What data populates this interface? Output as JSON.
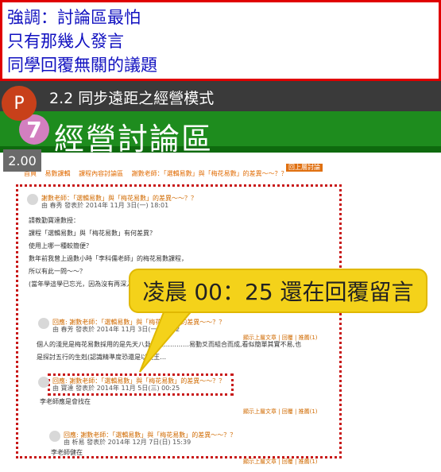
{
  "note_box": {
    "lines": [
      "強調：討論區最怕",
      "只有那幾人發言",
      "同學回覆無關的議題"
    ]
  },
  "slide": {
    "badge_letter": "P",
    "title": "2.2 同步遠距之經營模式",
    "number_icon": "7",
    "forum_title": "經營討論區",
    "speed": "2.00",
    "board_button": "回上層討論區",
    "nav_links": [
      "首頁",
      "易數課輯",
      "課程內容討論區",
      "謝數老師：「選輯易數」與「梅花易數」的差異～～？？"
    ]
  },
  "posts": [
    {
      "title": "謝數老師：「選輯易數」與「梅花易數」的差異～～？？",
      "meta": "由 春秀 發表於 2014年 11月 3日(一) 18:01",
      "body": [
        "請教勤寶達數授：",
        "課程「選輯易數」與「梅花易數」有何差異？",
        "使用上哪一種較簡便？",
        "數年前我曾上過數小時「李科儒老師」的梅花易數課程，",
        "所以有此一問～～？",
        "(當年學這學已忘光，因為沒有再深入研究)"
      ]
    },
    {
      "title": "回應: 謝數老師：「選輯易數」與「梅花易數」的差異～～？？",
      "meta": "由 春芳 發表於 2014年 11月 3日(一) 23:22",
      "body": [
        "個人的淺見是梅花易數採用的是先天八卦與以…………易動爻而組合而成,看似簡單其實不易,也",
        "是探討五行的生剋(認識精準度恐還是以文王…"
      ]
    },
    {
      "title": "回應: 謝數老師：「選輯易數」與「梅花易數」的差異～～？？",
      "meta": "由 寶達 發表於 2014年 11月 5日(三) 00:25",
      "body": [
        "李老師應是會找在"
      ]
    },
    {
      "title": "回應: 謝數老師：「選輯易數」與「梅花易數」的差異～～？？",
      "meta": "由 析易 發表於 2014年 12月 7日(日) 15:39",
      "body": [
        "李老師健在"
      ]
    }
  ],
  "actions": "顯示上層文章 | 回覆 | 推薦(1)",
  "callout": {
    "text": "凌晨 00：25 還在回覆留言"
  }
}
